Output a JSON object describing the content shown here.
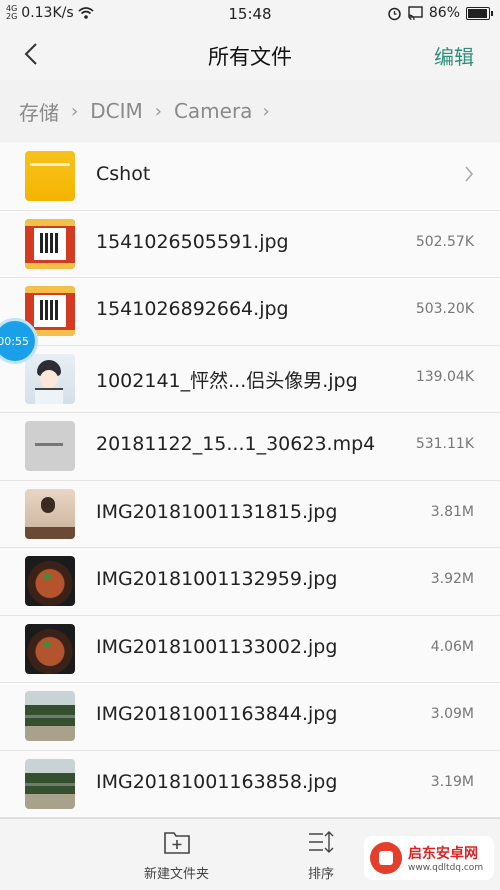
{
  "status_bar": {
    "net_a": "4G",
    "net_b": "2G",
    "speed": "0.13K/s",
    "time": "15:48",
    "battery": "86%",
    "battery_level": 0.86
  },
  "header": {
    "title": "所有文件",
    "edit": "编辑"
  },
  "breadcrumb": [
    "存储",
    "DCIM",
    "Camera"
  ],
  "files": [
    {
      "name": "Cshot",
      "size": "",
      "type": "folder"
    },
    {
      "name": "1541026505591.jpg",
      "size": "502.57K",
      "type": "qr"
    },
    {
      "name": "1541026892664.jpg",
      "size": "503.20K",
      "type": "qr"
    },
    {
      "name": "1002141_怦然...侣头像男.jpg",
      "size": "139.04K",
      "type": "anime"
    },
    {
      "name": "20181122_15...1_30623.mp4",
      "size": "531.11K",
      "type": "paper"
    },
    {
      "name": "IMG20181001131815.jpg",
      "size": "3.81M",
      "type": "person"
    },
    {
      "name": "IMG20181001132959.jpg",
      "size": "3.92M",
      "type": "food"
    },
    {
      "name": "IMG20181001133002.jpg",
      "size": "4.06M",
      "type": "food"
    },
    {
      "name": "IMG20181001163844.jpg",
      "size": "3.09M",
      "type": "trees"
    },
    {
      "name": "IMG20181001163858.jpg",
      "size": "3.19M",
      "type": "trees"
    }
  ],
  "floating_timer": "00:55",
  "bottom_bar": {
    "new_folder": "新建文件夹",
    "sort": "排序"
  },
  "watermark": {
    "title": "启东安卓网",
    "url": "www.qdltdq.com"
  },
  "colors": {
    "accent": "#2f8f7a",
    "folder": "#f4b500",
    "floating": "#1aa0e8"
  }
}
